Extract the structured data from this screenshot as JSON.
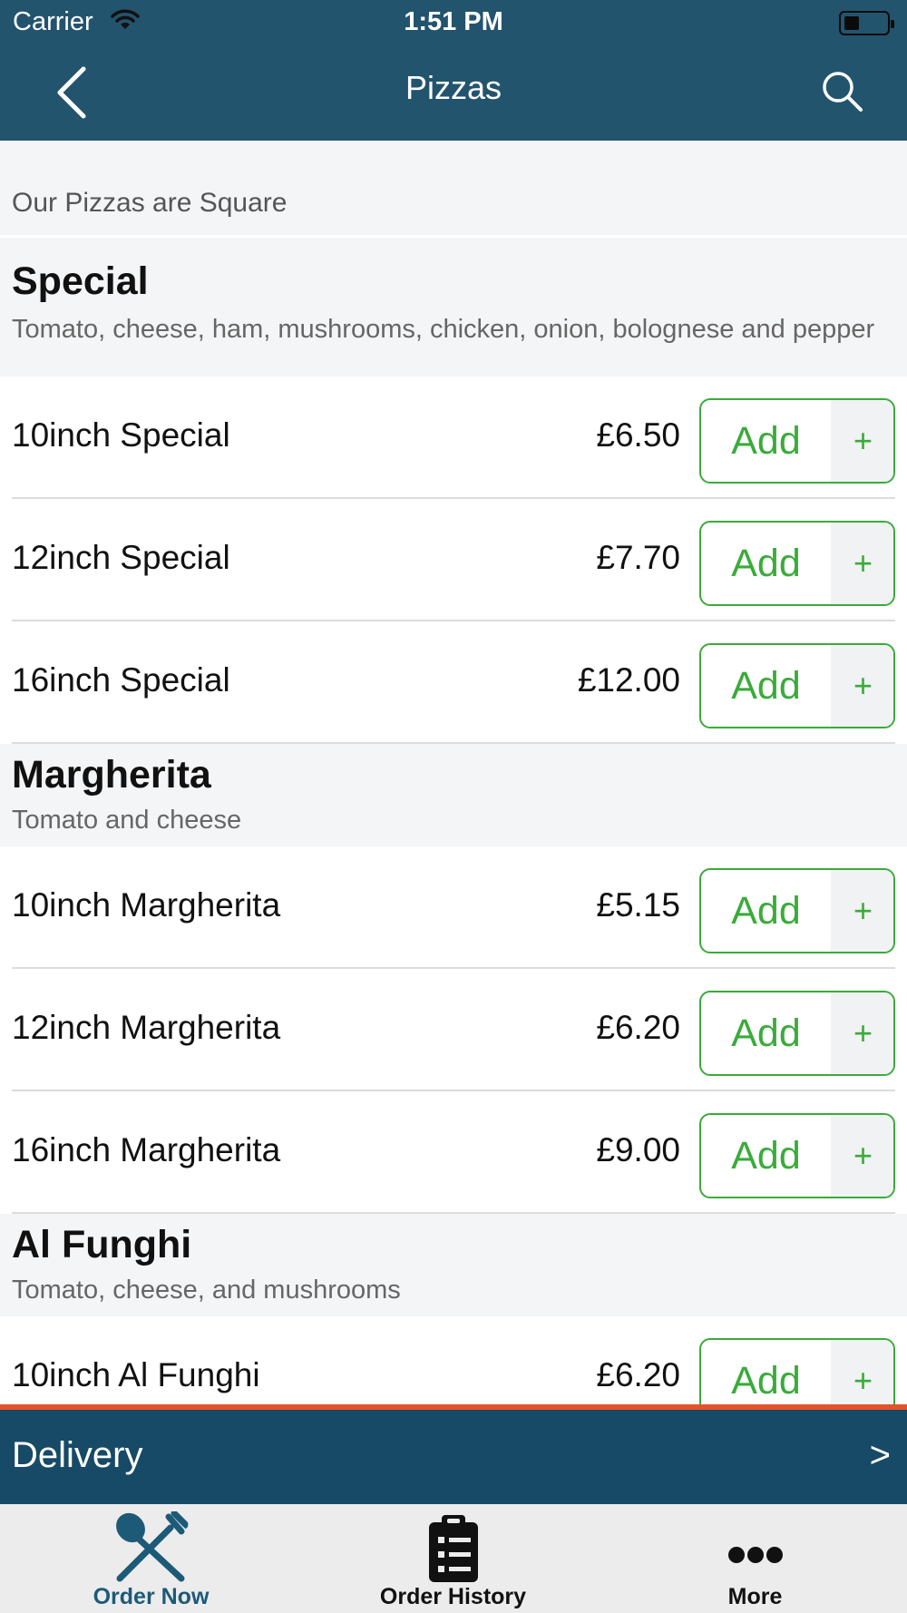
{
  "status_bar": {
    "carrier": "Carrier",
    "time": "1:51 PM"
  },
  "nav": {
    "title": "Pizzas"
  },
  "notice": "Our Pizzas are Square",
  "sections": [
    {
      "name": "Special",
      "description": "Tomato, cheese, ham, mushrooms, chicken, onion, bolognese and pepper",
      "items": [
        {
          "name": "10inch Special",
          "price": "£6.50",
          "add_label": "Add",
          "add_plus": "+"
        },
        {
          "name": "12inch Special",
          "price": "£7.70",
          "add_label": "Add",
          "add_plus": "+"
        },
        {
          "name": "16inch Special",
          "price": "£12.00",
          "add_label": "Add",
          "add_plus": "+"
        }
      ]
    },
    {
      "name": "Margherita",
      "description": "Tomato and cheese",
      "items": [
        {
          "name": "10inch Margherita",
          "price": "£5.15",
          "add_label": "Add",
          "add_plus": "+"
        },
        {
          "name": "12inch Margherita",
          "price": "£6.20",
          "add_label": "Add",
          "add_plus": "+"
        },
        {
          "name": "16inch Margherita",
          "price": "£9.00",
          "add_label": "Add",
          "add_plus": "+"
        }
      ]
    },
    {
      "name": "Al Funghi",
      "description": "Tomato, cheese, and mushrooms",
      "items": [
        {
          "name": "10inch Al Funghi",
          "price": "£6.20",
          "add_label": "Add",
          "add_plus": "+"
        }
      ]
    }
  ],
  "delivery": {
    "label": "Delivery",
    "arrow": ">"
  },
  "tabs": [
    {
      "label": "Order Now",
      "icon": "fork-knife-icon",
      "active": true
    },
    {
      "label": "Order History",
      "icon": "clipboard-list-icon",
      "active": false
    },
    {
      "label": "More",
      "icon": "more-dots-icon",
      "active": false
    }
  ],
  "colors": {
    "header": "#23546e",
    "delivery_bar": "#164a66",
    "accent_green": "#3aab3a",
    "accent_orange": "#e5532a",
    "tab_active": "#1d5a78"
  }
}
